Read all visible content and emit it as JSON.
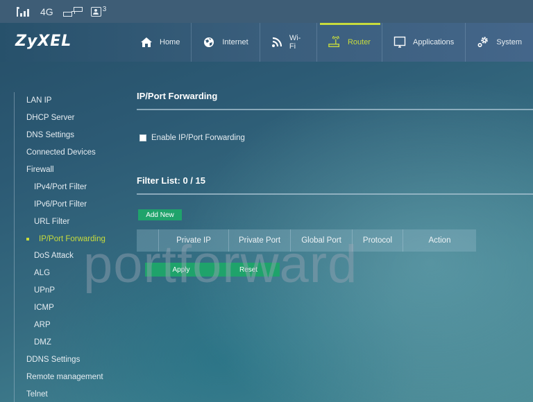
{
  "status_bar": {
    "signal_icon": "signal-bars-icon",
    "network_type": "4G",
    "network_icon": "network-topology-icon",
    "users_icon": "user-icon",
    "users_count": "3"
  },
  "header": {
    "logo": "ZyXEL",
    "nav": [
      {
        "label": "Home",
        "icon": "home-icon",
        "active": false
      },
      {
        "label": "Internet",
        "icon": "globe-icon",
        "active": false
      },
      {
        "label": "Wi-Fi",
        "icon": "wifi-icon",
        "active": false
      },
      {
        "label": "Router",
        "icon": "router-icon",
        "active": true
      },
      {
        "label": "Applications",
        "icon": "monitor-icon",
        "active": false
      },
      {
        "label": "System",
        "icon": "gears-icon",
        "active": false
      }
    ]
  },
  "sidebar": {
    "items": [
      {
        "label": "LAN IP",
        "level": 1
      },
      {
        "label": "DHCP Server",
        "level": 1
      },
      {
        "label": "DNS Settings",
        "level": 1
      },
      {
        "label": "Connected Devices",
        "level": 1
      },
      {
        "label": "Firewall",
        "level": 1
      },
      {
        "label": "IPv4/Port Filter",
        "level": 2
      },
      {
        "label": "IPv6/Port Filter",
        "level": 2
      },
      {
        "label": "URL Filter",
        "level": 2
      },
      {
        "label": "IP/Port Forwarding",
        "level": 2,
        "active": true
      },
      {
        "label": "DoS Attack",
        "level": 2
      },
      {
        "label": "ALG",
        "level": 2
      },
      {
        "label": "UPnP",
        "level": 2
      },
      {
        "label": "ICMP",
        "level": 2
      },
      {
        "label": "ARP",
        "level": 2
      },
      {
        "label": "DMZ",
        "level": 2
      },
      {
        "label": "DDNS Settings",
        "level": 1
      },
      {
        "label": "Remote management",
        "level": 1
      },
      {
        "label": "Telnet",
        "level": 1
      }
    ]
  },
  "main": {
    "title": "IP/Port Forwarding",
    "enable_checkbox": {
      "label": "Enable IP/Port Forwarding",
      "checked": false
    },
    "filter_list_title": "Filter List: 0 / 15",
    "add_new_label": "Add New",
    "table": {
      "columns": [
        "",
        "Private IP",
        "Private Port",
        "Global Port",
        "Protocol",
        "Action"
      ],
      "rows": []
    },
    "apply_label": "Apply",
    "reset_label": "Reset"
  },
  "watermark": "portforward",
  "colors": {
    "accent": "#c8dc3c",
    "button_green": "#1fa36b"
  }
}
